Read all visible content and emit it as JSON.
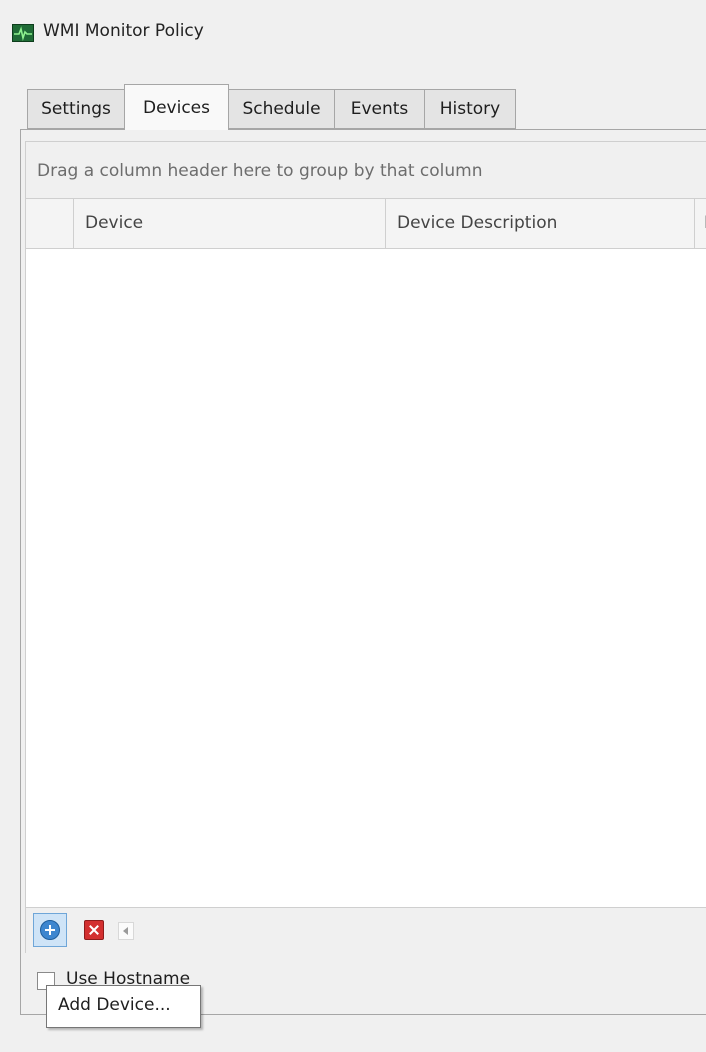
{
  "window": {
    "title": "WMI Monitor Policy",
    "icon": "monitor-pulse-icon"
  },
  "tabs": [
    {
      "label": "Settings",
      "active": false
    },
    {
      "label": "Devices",
      "active": true
    },
    {
      "label": "Schedule",
      "active": false
    },
    {
      "label": "Events",
      "active": false
    },
    {
      "label": "History",
      "active": false
    }
  ],
  "grid": {
    "group_hint": "Drag a column header here to group by that column",
    "columns": [
      "Device",
      "Device Description",
      "I"
    ],
    "rows": []
  },
  "toolbar": {
    "add_icon": "add-circle-icon",
    "delete_icon": "delete-x-icon",
    "scroll_icon": "scroll-left-arrow-icon"
  },
  "options": {
    "checkbox_label": "Use Hostname",
    "checked": false
  },
  "tooltip": {
    "text": "Add Device..."
  },
  "colors": {
    "accent": "#3d86cf",
    "delete": "#d32f2f",
    "icon_green": "#1f6b36"
  }
}
